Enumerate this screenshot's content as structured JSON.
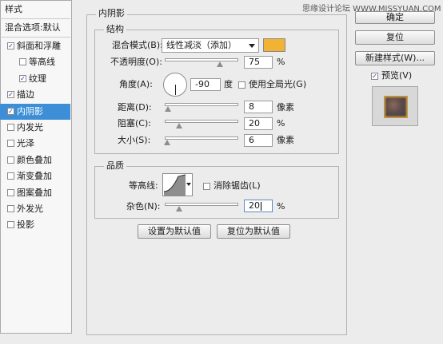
{
  "watermark": "思缘设计论坛 WWW.MISSYUAN.COM",
  "sidebar": {
    "header": "样式",
    "blend_options": "混合选项:默认",
    "items": [
      {
        "label": "斜面和浮雕",
        "checked": true
      },
      {
        "label": "等高线",
        "checked": false
      },
      {
        "label": "纹理",
        "checked": true
      },
      {
        "label": "描边",
        "checked": true
      },
      {
        "label": "内阴影",
        "checked": true
      },
      {
        "label": "内发光",
        "checked": false
      },
      {
        "label": "光泽",
        "checked": false
      },
      {
        "label": "颜色叠加",
        "checked": false
      },
      {
        "label": "渐变叠加",
        "checked": false
      },
      {
        "label": "图案叠加",
        "checked": false
      },
      {
        "label": "外发光",
        "checked": false
      },
      {
        "label": "投影",
        "checked": false
      }
    ]
  },
  "panel": {
    "title": "内阴影",
    "structure": {
      "title": "结构",
      "blend_mode_label": "混合模式(B):",
      "blend_mode_value": "线性减淡（添加）",
      "color": "#f2b233",
      "opacity_label": "不透明度(O):",
      "opacity_value": "75",
      "opacity_fraction": 0.75,
      "percent": "%",
      "angle_label": "角度(A):",
      "angle_value": "-90",
      "angle_unit": "度",
      "global_light_label": "使用全局光(G)",
      "global_light_checked": false,
      "distance_label": "距离(D):",
      "distance_value": "8",
      "distance_fraction": 0.04,
      "choke_label": "阻塞(C):",
      "choke_value": "20",
      "choke_fraction": 0.2,
      "size_label": "大小(S):",
      "size_value": "6",
      "size_fraction": 0.03,
      "px_unit": "像素"
    },
    "quality": {
      "title": "品质",
      "contour_label": "等高线:",
      "antialias_label": "消除锯齿(L)",
      "antialias_checked": false,
      "noise_label": "杂色(N):",
      "noise_value": "20",
      "noise_fraction": 0.2
    },
    "set_default": "设置为默认值",
    "reset_default": "复位为默认值"
  },
  "right": {
    "ok": "确定",
    "reset": "复位",
    "new_style": "新建样式(W)...",
    "preview_label": "预览(V)",
    "preview_checked": true
  }
}
